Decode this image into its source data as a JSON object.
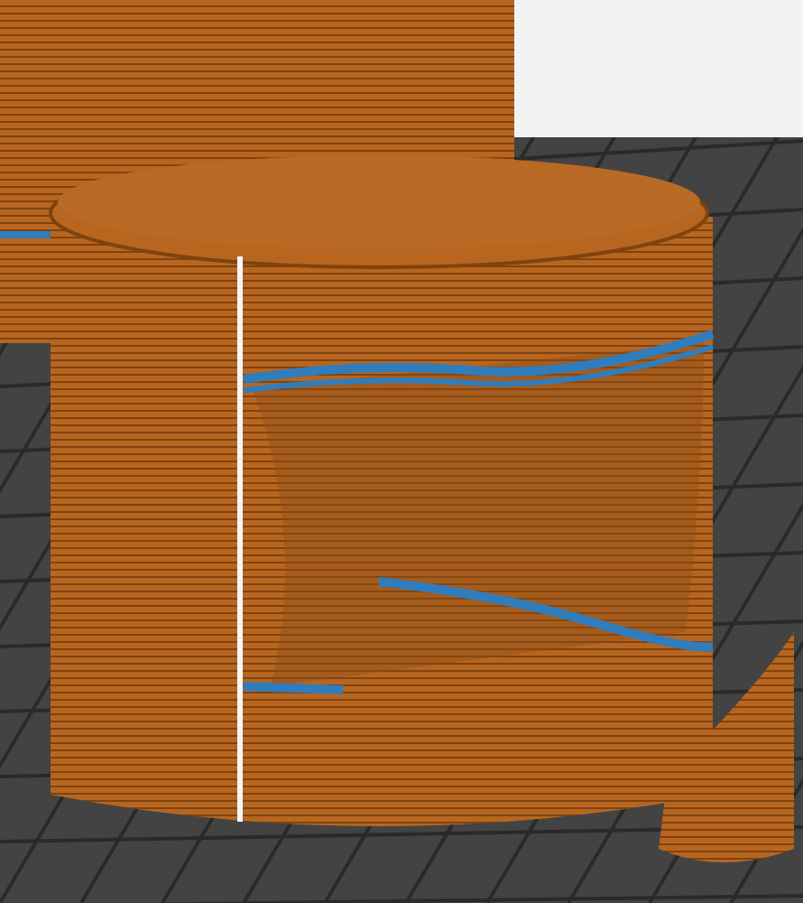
{
  "viewport": {
    "kind": "layer-preview"
  }
}
